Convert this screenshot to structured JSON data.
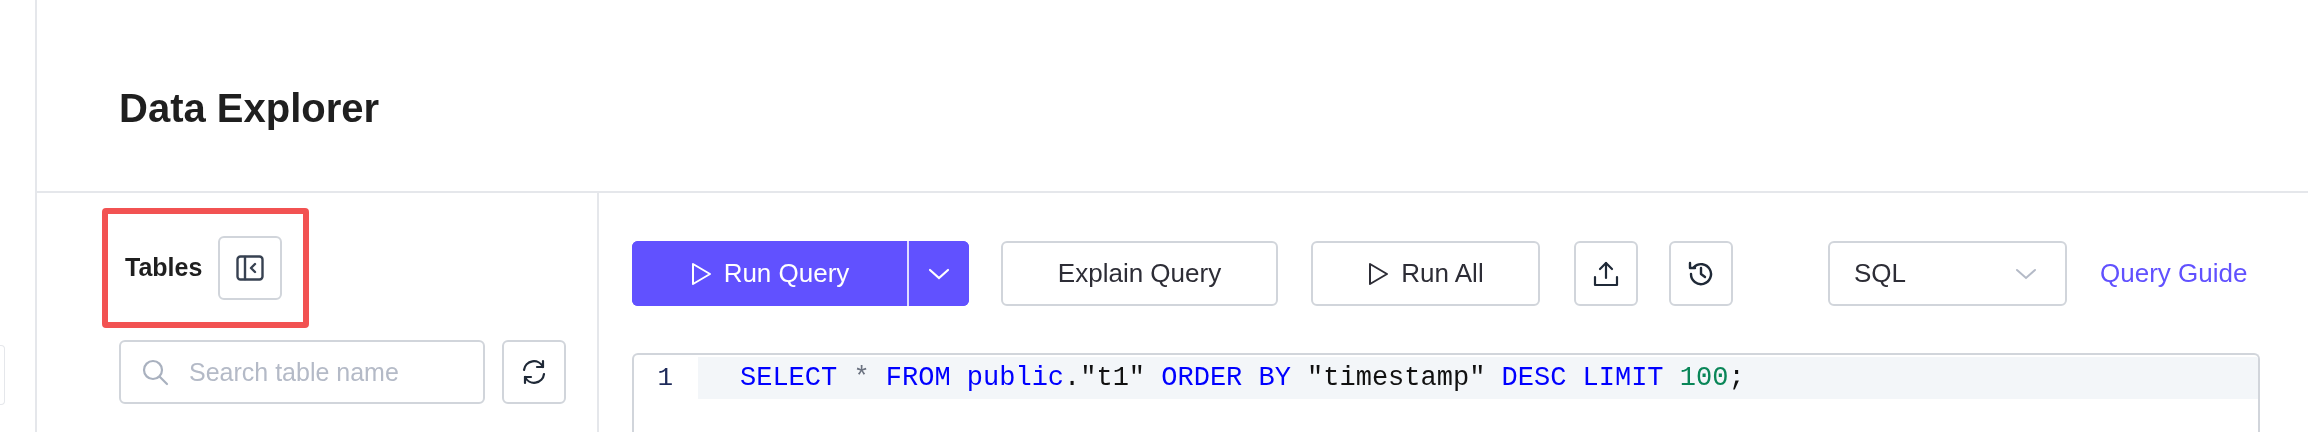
{
  "page": {
    "title": "Data Explorer"
  },
  "tables_panel": {
    "title": "Tables",
    "highlighted": true,
    "search": {
      "placeholder": "Search table name"
    }
  },
  "toolbar": {
    "run_query": "Run Query",
    "explain_query": "Explain Query",
    "run_all": "Run All",
    "language": "SQL",
    "guide_link": "Query Guide"
  },
  "editor": {
    "lines": [
      {
        "number": "1",
        "tokens": [
          {
            "kind": "keyword",
            "text": "SELECT"
          },
          {
            "kind": "operator",
            "text": " * "
          },
          {
            "kind": "keyword",
            "text": "FROM public"
          },
          {
            "kind": "plain",
            "text": ".\"t1\" "
          },
          {
            "kind": "keyword",
            "text": "ORDER BY "
          },
          {
            "kind": "plain",
            "text": "\"timestamp\" "
          },
          {
            "kind": "keyword",
            "text": "DESC LIMIT "
          },
          {
            "kind": "number",
            "text": "100"
          },
          {
            "kind": "plain",
            "text": ";"
          }
        ]
      }
    ]
  }
}
